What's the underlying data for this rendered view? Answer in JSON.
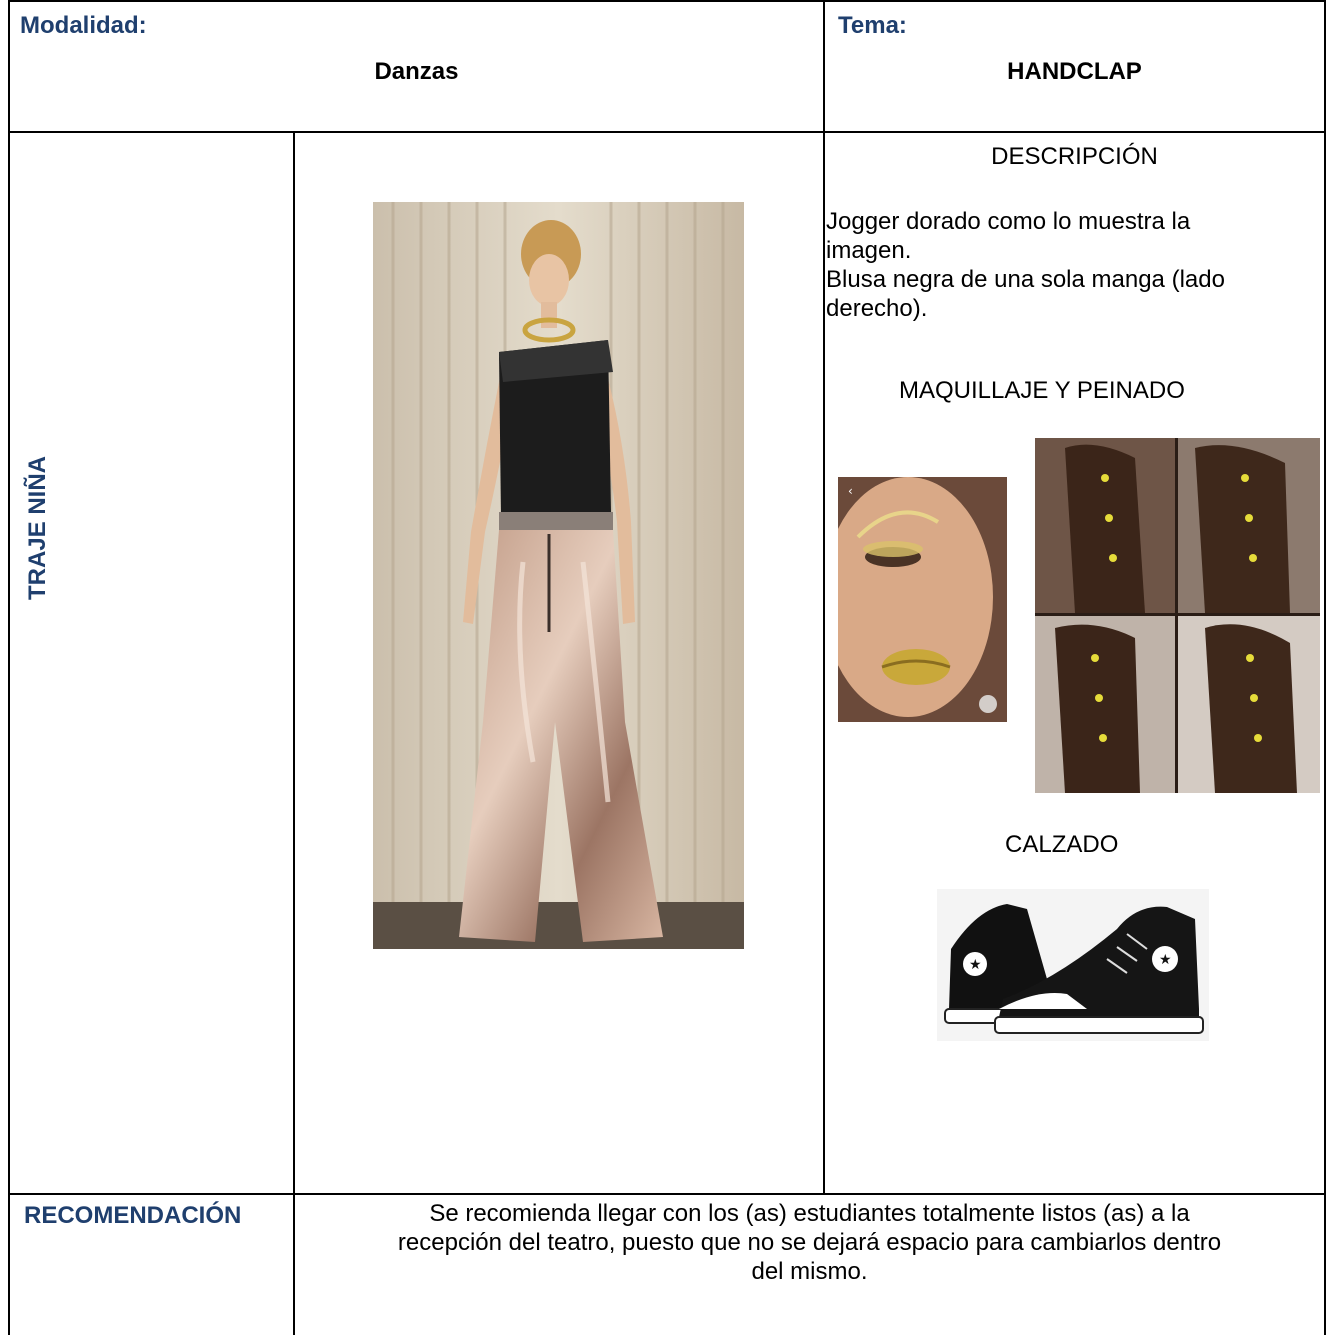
{
  "header": {
    "modalidad_label": "Modalidad:",
    "modalidad_value": "Danzas",
    "tema_label": "Tema:",
    "tema_value": "HANDCLAP"
  },
  "section": {
    "side_label": "TRAJE NIÑA",
    "descripcion_title": "DESCRIPCIÓN",
    "descripcion_lines": [
      "Jogger dorado como lo muestra la",
      "imagen.",
      "Blusa negra de una sola manga (lado",
      "derecho)."
    ],
    "maquillaje_title": "MAQUILLAJE Y PEINADO",
    "calzado_title": "CALZADO"
  },
  "recommendation": {
    "label": "RECOMENDACIÓN",
    "lines": [
      "Se recomienda llegar con los (as) estudiantes totalmente listos (as) a la",
      "recepción del teatro, puesto que no se dejará espacio para cambiarlos dentro",
      "del mismo."
    ]
  },
  "colors": {
    "label_blue": "#1f3f6e",
    "border": "#000000"
  },
  "images": {
    "outfit": "outfit-photo",
    "makeup": "makeup-photo",
    "hair": "hairstyle-collage",
    "shoes": "sneakers-photo"
  }
}
